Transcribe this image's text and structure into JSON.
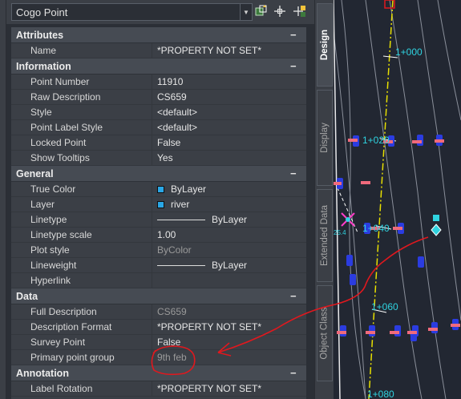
{
  "selector": {
    "value": "Cogo Point"
  },
  "categories": {
    "attributes": "Attributes",
    "information": "Information",
    "general": "General",
    "data": "Data",
    "annotation": "Annotation"
  },
  "collapse_glyph": "−",
  "attributes": [
    {
      "key": "Name",
      "value": "*PROPERTY NOT SET*"
    }
  ],
  "information": [
    {
      "key": "Point Number",
      "value": "11910"
    },
    {
      "key": "Raw Description",
      "value": "CS659"
    },
    {
      "key": "Style",
      "value": "<default>"
    },
    {
      "key": "Point Label Style",
      "value": "<default>"
    },
    {
      "key": "Locked Point",
      "value": "False"
    },
    {
      "key": "Show Tooltips",
      "value": "Yes"
    }
  ],
  "general": [
    {
      "key": "True Color",
      "value": "ByLayer",
      "swatch": "#2aa7e6"
    },
    {
      "key": "Layer",
      "value": "river",
      "swatch": "#2aa7e6"
    },
    {
      "key": "Linetype",
      "value": "ByLayer"
    },
    {
      "key": "Linetype scale",
      "value": "1.00"
    },
    {
      "key": "Plot style",
      "value": "ByColor"
    },
    {
      "key": "Lineweight",
      "value": "ByLayer"
    },
    {
      "key": "Hyperlink",
      "value": ""
    }
  ],
  "data": [
    {
      "key": "Full Description",
      "value": "CS659"
    },
    {
      "key": "Description Format",
      "value": "*PROPERTY NOT SET*"
    },
    {
      "key": "Survey Point",
      "value": "False"
    },
    {
      "key": "Primary point group",
      "value": "9th feb"
    }
  ],
  "annotation": [
    {
      "key": "Label Rotation",
      "value": "*PROPERTY NOT SET*"
    }
  ],
  "tabs": [
    "Design",
    "Display",
    "Extended Data",
    "Object Class"
  ],
  "stations": [
    "1+000",
    "1+020",
    "1+040",
    "1+060",
    "1+080"
  ],
  "point_label": "25.4",
  "colors": {
    "station_text": "#2fd3e0",
    "alignment": "#e8e000",
    "annotation_red": "#e0181e",
    "marker_blue": "#2b3ce0",
    "marker_pink": "#f06a7c"
  }
}
